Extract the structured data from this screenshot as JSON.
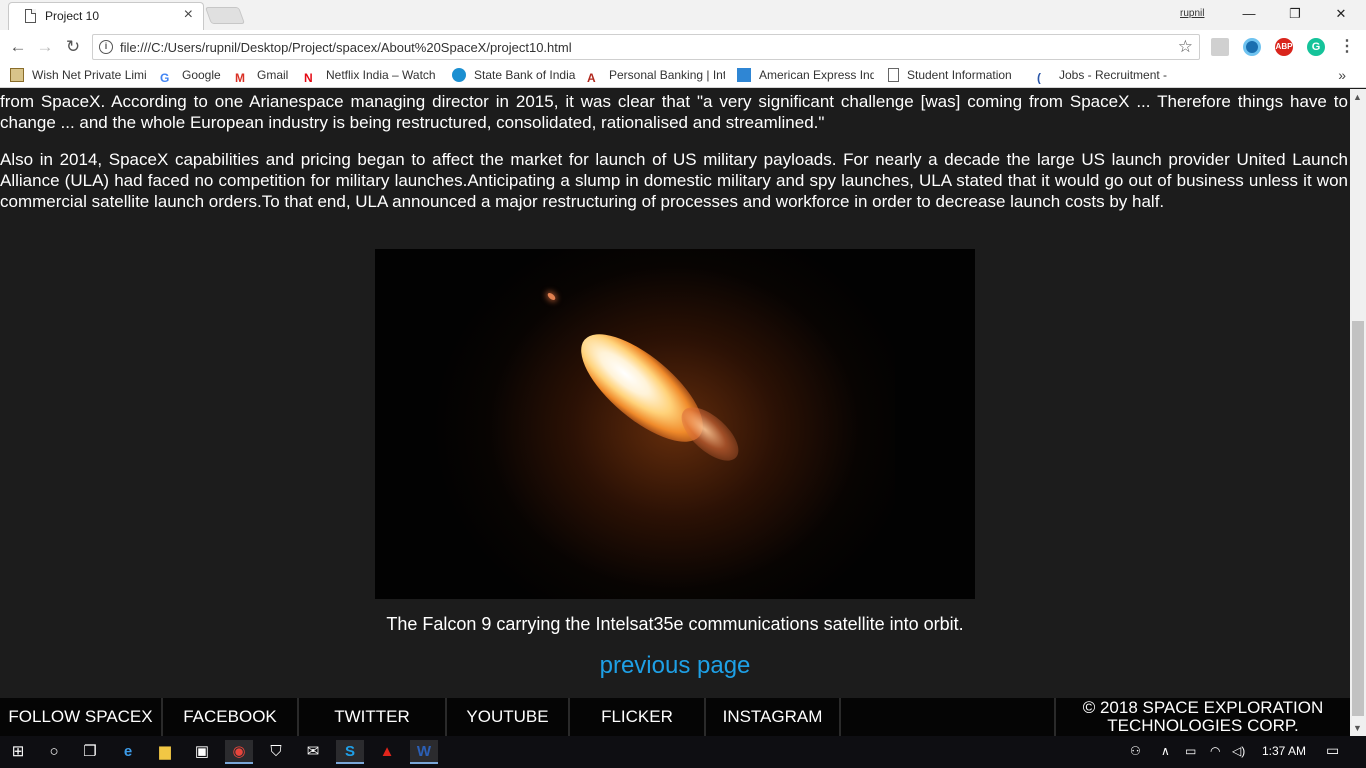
{
  "browser": {
    "tab_title": "Project 10",
    "tab_close": "×",
    "user_name": "rupnil",
    "window_controls": {
      "minimize": "—",
      "maximize": "❐",
      "close": "✕"
    },
    "nav": {
      "back": "←",
      "forward": "→",
      "reload": "↻"
    },
    "url": "file:///C:/Users/rupnil/Desktop/Project/spacex/About%20SpaceX/project10.html",
    "info_icon": "i",
    "star": "☆",
    "extensions": [
      {
        "name": "extension-icon",
        "label": ""
      },
      {
        "name": "eye-extension-icon",
        "label": ""
      },
      {
        "name": "adblock-plus-icon",
        "label": "ABP"
      },
      {
        "name": "grammarly-icon",
        "label": "G"
      }
    ],
    "menu": "⋮",
    "bookmarks": [
      "Wish Net Private Limi",
      "Google",
      "Gmail",
      "Netflix India – Watch",
      "State Bank of India",
      "Personal Banking | Int",
      "American Express Ind",
      "Student Information",
      "Jobs - Recruitment -"
    ],
    "bookmarks_more": "»"
  },
  "page": {
    "paragraph1": "from SpaceX. According to one Arianespace managing director in 2015, it was clear that \"a very significant challenge [was] coming from SpaceX ... Therefore things have to change ... and the whole European industry is being restructured, consolidated, rationalised and streamlined.\"",
    "paragraph2": "Also in 2014, SpaceX capabilities and pricing began to affect the market for launch of US military payloads. For nearly a decade the large US launch provider United Launch Alliance (ULA) had faced no competition for military launches.Anticipating a slump in domestic military and spy launches, ULA stated that it would go out of business unless it won commercial satellite launch orders.To that end, ULA announced a major restructuring of processes and workforce in order to decrease launch costs by half.",
    "caption": "The Falcon 9 carrying the Intelsat35e communications satellite into orbit.",
    "previous_link": "previous page"
  },
  "footer": {
    "items": [
      "FOLLOW SPACEX",
      "FACEBOOK",
      "TWITTER",
      "YOUTUBE",
      "FLICKER",
      "INSTAGRAM"
    ],
    "copyright_line1": "© 2018 SPACE EXPLORATION",
    "copyright_line2": "TECHNOLOGIES CORP."
  },
  "taskbar": {
    "time": "1:37 AM"
  },
  "colors": {
    "page_bg": "#1c1c1c",
    "link": "#1ea0e6",
    "footer_bg": "#050505"
  }
}
